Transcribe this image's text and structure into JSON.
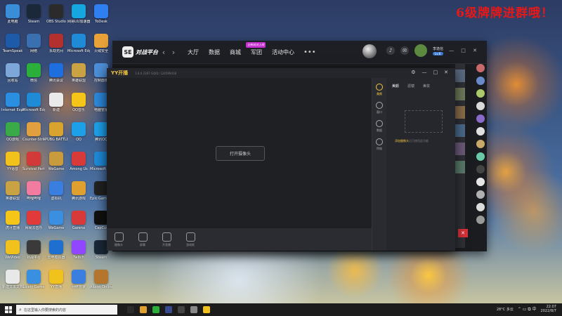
{
  "promo_text": "6级牌牌进群哦！",
  "desktop_icons": [
    {
      "label": "此电脑",
      "color": "#3a8ed8"
    },
    {
      "label": "Steam",
      "color": "#1b2838"
    },
    {
      "label": "OBS Studio",
      "color": "#2b2b2b"
    },
    {
      "label": "网易UU加速器",
      "color": "#17a7e0"
    },
    {
      "label": "ToDesk",
      "color": "#2f7ff0"
    },
    {
      "label": "TeamSpeak",
      "color": "#1d5aa8"
    },
    {
      "label": "网络",
      "color": "#3a6fb0"
    },
    {
      "label": "永劫无间",
      "color": "#b3302f"
    },
    {
      "label": "Microsoft Edge",
      "color": "#1f8ad6"
    },
    {
      "label": "火绒安全",
      "color": "#e8a23a"
    },
    {
      "label": "回收站",
      "color": "#7da7d9"
    },
    {
      "label": "微信",
      "color": "#2ab03a"
    },
    {
      "label": "腾讯会议",
      "color": "#1d6fe0"
    },
    {
      "label": "英雄联盟",
      "color": "#c9a244"
    },
    {
      "label": "控制面板",
      "color": "#4d8fd8"
    },
    {
      "label": "Internet Explorer",
      "color": "#2a8fe0"
    },
    {
      "label": "Microsoft Edge",
      "color": "#1f8ad6"
    },
    {
      "label": "新建",
      "color": "#eaeaea"
    },
    {
      "label": "QQ音乐",
      "color": "#f5c518"
    },
    {
      "label": "电脑管家",
      "color": "#2c88d8"
    },
    {
      "label": "QQ游戏",
      "color": "#3aaa48"
    },
    {
      "label": "Counter-Strike Global Offensive",
      "color": "#e0a040"
    },
    {
      "label": "PUBG BATTLEGROUNDS",
      "color": "#d9a330"
    },
    {
      "label": "QQ",
      "color": "#1ea0e8"
    },
    {
      "label": "腾讯QQ",
      "color": "#1ea0e8"
    },
    {
      "label": "YY语音",
      "color": "#f2c21c"
    },
    {
      "label": "Survival Party",
      "color": "#d23a3a"
    },
    {
      "label": "WeGame",
      "color": "#c89b3c"
    },
    {
      "label": "Among Us",
      "color": "#d83a3a"
    },
    {
      "label": "Microsoft Edge",
      "color": "#1f8ad6"
    },
    {
      "label": "英雄联盟",
      "color": "#c9a244"
    },
    {
      "label": "哔哩哔哩",
      "color": "#f27ca0"
    },
    {
      "label": "虚拟机",
      "color": "#3a7fe0"
    },
    {
      "label": "腾讯游戏",
      "color": "#e0a030"
    },
    {
      "label": "Epic Games Launcher",
      "color": "#222222"
    },
    {
      "label": "虎牙直播",
      "color": "#f5c518"
    },
    {
      "label": "网易云音乐",
      "color": "#e03a3a"
    },
    {
      "label": "WeGame",
      "color": "#3a8fe0"
    },
    {
      "label": "Garena",
      "color": "#d83a3a"
    },
    {
      "label": "CapCut",
      "color": "#111111"
    },
    {
      "label": "WeVideo",
      "color": "#f2c21c"
    },
    {
      "label": "对战平台",
      "color": "#3a3a3a"
    },
    {
      "label": "雷电模拟器",
      "color": "#1f6fd0"
    },
    {
      "label": "Twitch",
      "color": "#9146ff"
    },
    {
      "label": "Steam",
      "color": "#1b2838"
    },
    {
      "label": "新建文本文档",
      "color": "#e8e8e8"
    },
    {
      "label": "Lively Game",
      "color": "#3a8fe0"
    },
    {
      "label": "YY直播",
      "color": "#f2c21c"
    },
    {
      "label": "网络管家",
      "color": "#3a7fe0"
    },
    {
      "label": "Albion Online",
      "color": "#b4762c"
    }
  ],
  "main_window": {
    "logo_text": "对战平台",
    "back_arrow": "‹",
    "forward_arrow": "›",
    "nav": [
      "大厅",
      "数据",
      "商城",
      "军团",
      "活动中心"
    ],
    "nav_badge": "全新玩法上线",
    "more": "•••",
    "user_name": "李逸信",
    "user_level": "Lv.8",
    "window_controls": "— □ ✕",
    "icon_bell": "♪",
    "icon_mail": "✉"
  },
  "yy_window": {
    "title": "YY开播",
    "version": "1.8.0.2287  GQID: 124569418",
    "controls": [
      "⚙",
      "—",
      "□",
      "✕"
    ],
    "open_camera_button": "打开摄像头",
    "side_tabs": [
      {
        "label": "美颜",
        "active": true
      },
      {
        "label": "窗口",
        "active": false
      },
      {
        "label": "数据",
        "active": false
      },
      {
        "label": "特效",
        "active": false
      }
    ],
    "panel_tabs": [
      {
        "label": "美颜",
        "active": true
      },
      {
        "label": "滤镜",
        "active": false
      },
      {
        "label": "美妆",
        "active": false
      }
    ],
    "empty_hint_link": "添加摄像头",
    "empty_hint_rest": "后可使用此功能",
    "tools": [
      "摄像头",
      "屏幕",
      "开直播",
      "游戏框"
    ]
  },
  "taskbar": {
    "search_placeholder": "在这里输入你要搜索的内容",
    "search_glyph": "⌕",
    "weather": "28°C 多云",
    "time": "22:07",
    "date": "2022/8/7",
    "tray_symbols": "⌃ ▭ ⧉ 中",
    "pinned_colors": [
      "#2c2c2c",
      "#e0a030",
      "#2ab03a",
      "#3a4a8f",
      "#444444",
      "#888888",
      "#f2c21c"
    ]
  }
}
